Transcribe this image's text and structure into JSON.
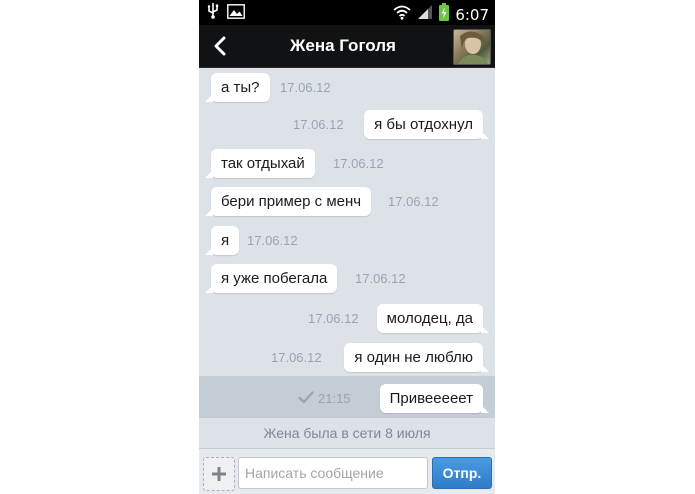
{
  "status_bar": {
    "time": "6:07",
    "icons": [
      "usb-icon",
      "image-icon",
      "wifi-icon",
      "signal-icon",
      "battery-icon"
    ]
  },
  "header": {
    "title": "Жена Гоголя"
  },
  "messages": [
    {
      "text": "а ты?",
      "time": "17.06.12",
      "direction": "in"
    },
    {
      "text": "я бы отдохнул",
      "time": "17.06.12",
      "direction": "out"
    },
    {
      "text": "так отдыхай",
      "time": "17.06.12",
      "direction": "in"
    },
    {
      "text": "бери пример с менч",
      "time": "17.06.12",
      "direction": "in"
    },
    {
      "text": "я",
      "time": "17.06.12",
      "direction": "in"
    },
    {
      "text": "я уже побегала",
      "time": "17.06.12",
      "direction": "in"
    },
    {
      "text": "молодец, да",
      "time": "17.06.12",
      "direction": "out"
    },
    {
      "text": "я один не люблю",
      "time": "17.06.12",
      "direction": "out"
    },
    {
      "text": "Привееееет",
      "time": "21:15",
      "direction": "out",
      "delivered": true
    }
  ],
  "online_status": "Жена была в сети 8 июля",
  "composer": {
    "placeholder": "Написать сообщение",
    "value": "",
    "send_label": "Отпр."
  },
  "colors": {
    "background": "#dde2e8",
    "header": "#111214",
    "bubble": "#ffffff",
    "timestamp": "#9aa4b1",
    "send_button": "#3a8ad6",
    "highlight_row": "#c4ccd6"
  }
}
